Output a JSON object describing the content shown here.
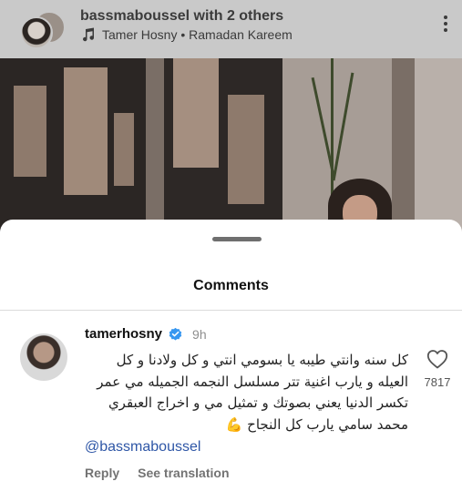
{
  "post": {
    "author": "bassmaboussel with 2 others",
    "music": "Tamer Hosny • Ramadan Kareem"
  },
  "sheet": {
    "title": "Comments"
  },
  "comment": {
    "username": "tamerhosny",
    "time": "9h",
    "text": "كل سنه وانتي طيبه يا بسومي انتي و كل ولادنا و كل العيله  و يارب اغنية تتر مسلسل النجمه الجميله مي عمر تكسر الدنيا  يعني بصوتك و تمثيل مي و اخراج العبقري محمد سامي  يارب كل النجاح 💪",
    "mention": "@bassmaboussel",
    "reply_label": "Reply",
    "see_translation_label": "See translation",
    "like_count": "7817"
  },
  "colors": {
    "verified": "#3797f0",
    "mention": "#2e56a6",
    "dim_overlay": "#c9c9c9"
  },
  "icons": [
    "music-note-icon",
    "more-options-icon",
    "verified-badge-icon",
    "heart-icon"
  ]
}
